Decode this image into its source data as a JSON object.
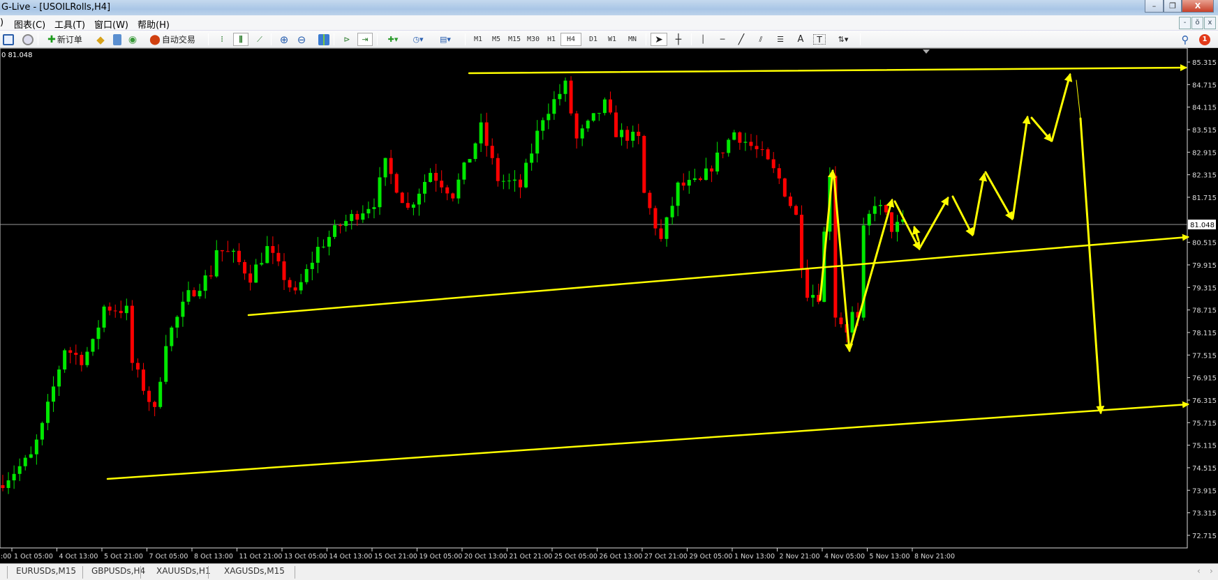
{
  "window": {
    "title": "G-Live - [USOILRolls,H4]",
    "minimize": "–",
    "restore": "❐",
    "close": "X"
  },
  "menu": {
    "partial": ")",
    "items": [
      "图表(C)",
      "工具(T)",
      "窗口(W)",
      "帮助(H)"
    ]
  },
  "mdi": {
    "minimize": "-",
    "restore": "ŏ",
    "close": "x"
  },
  "toolbar": {
    "new_order": "新订单",
    "auto_trading": "自动交易",
    "timeframes": [
      "M1",
      "M5",
      "M15",
      "M30",
      "H1",
      "H4",
      "D1",
      "W1",
      "MN"
    ],
    "active_timeframe": "H4",
    "text_tool": "A",
    "label_tool": "T",
    "notification_count": "1"
  },
  "chart_info": {
    "header": "0 81.048",
    "current_price": "81.048"
  },
  "chart_data": {
    "type": "candlestick",
    "symbol": "USOILRolls",
    "timeframe": "H4",
    "colors": {
      "up": "#00e800",
      "down": "#ff0000",
      "background": "#000000",
      "drawings": "#ffff00",
      "grid_line": "#999999"
    },
    "y_range": [
      72.715,
      85.315
    ],
    "y_ticks": [
      "85.315",
      "84.715",
      "84.115",
      "83.515",
      "82.915",
      "82.315",
      "81.715",
      "81.048",
      "80.515",
      "79.915",
      "79.315",
      "78.715",
      "78.115",
      "77.515",
      "76.915",
      "76.315",
      "75.715",
      "75.115",
      "74.515",
      "73.915",
      "73.315",
      "72.715"
    ],
    "x_ticks": [
      ":00",
      "1 Oct 05:00",
      "4 Oct 13:00",
      "5 Oct 21:00",
      "7 Oct 05:00",
      "8 Oct 13:00",
      "11 Oct 21:00",
      "13 Oct 05:00",
      "14 Oct 13:00",
      "15 Oct 21:00",
      "19 Oct 05:00",
      "20 Oct 13:00",
      "21 Oct 21:00",
      "25 Oct 05:00",
      "26 Oct 13:00",
      "27 Oct 21:00",
      "29 Oct 05:00",
      "1 Nov 13:00",
      "2 Nov 21:00",
      "4 Nov 05:00",
      "5 Nov 13:00",
      "8 Nov 21:00"
    ],
    "bars_per_x_tick": 8,
    "price_path": [
      [
        0,
        74.15
      ],
      [
        5,
        74.8
      ],
      [
        7,
        75.6
      ],
      [
        11,
        77.7
      ],
      [
        14,
        77.4
      ],
      [
        16,
        77.8
      ],
      [
        18,
        78.8
      ],
      [
        22,
        78.7
      ],
      [
        23,
        77.3
      ],
      [
        27,
        76.0
      ],
      [
        29,
        77.9
      ],
      [
        33,
        79.1
      ],
      [
        37,
        79.7
      ],
      [
        38,
        80.35
      ],
      [
        41,
        80.15
      ],
      [
        44,
        79.6
      ],
      [
        47,
        80.35
      ],
      [
        52,
        79.1
      ],
      [
        56,
        80.35
      ],
      [
        60,
        80.97
      ],
      [
        66,
        81.6
      ],
      [
        68,
        82.6
      ],
      [
        72,
        81.4
      ],
      [
        76,
        82.4
      ],
      [
        80,
        81.8
      ],
      [
        83,
        82.8
      ],
      [
        85,
        83.56
      ],
      [
        88,
        82.2
      ],
      [
        92,
        82.0
      ],
      [
        96,
        83.87
      ],
      [
        100,
        84.69
      ],
      [
        102,
        83.25
      ],
      [
        107,
        84.18
      ],
      [
        109,
        83.45
      ],
      [
        113,
        83.25
      ],
      [
        114,
        81.8
      ],
      [
        117,
        80.56
      ],
      [
        120,
        82.0
      ],
      [
        124,
        82.1
      ],
      [
        130,
        83.45
      ],
      [
        135,
        82.83
      ],
      [
        138,
        82.2
      ],
      [
        141,
        81.2
      ],
      [
        142,
        80.0
      ],
      [
        143,
        79.2
      ],
      [
        145,
        79.1
      ],
      [
        147,
        82.4
      ],
      [
        148,
        78.6
      ],
      [
        150,
        78.2
      ],
      [
        151,
        78.6
      ],
      [
        152,
        78.4
      ],
      [
        153,
        80.8
      ],
      [
        155,
        81.6
      ],
      [
        157,
        81.2
      ],
      [
        158,
        80.9
      ],
      [
        160,
        81.0
      ]
    ]
  },
  "tabs": [
    "EURUSDs,M15",
    "GBPUSDs,H4",
    "XAUUSDs,H1",
    "XAGUSDs,M15"
  ]
}
